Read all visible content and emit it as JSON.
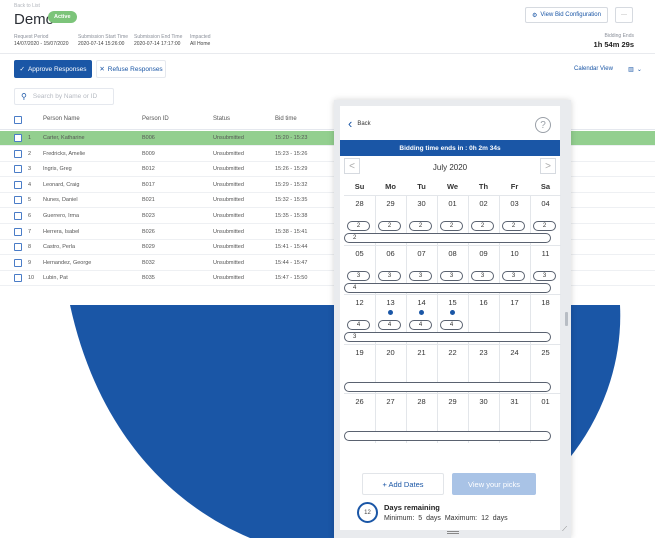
{
  "app": {
    "breadcrumb": "Back to List",
    "title": "Demo",
    "status": "Active",
    "meta": [
      {
        "label": "Request Period",
        "value": "14/07/2020 - 15/07/2020"
      },
      {
        "label": "Submission Start Time",
        "value": "2020-07-14 15:26:00"
      },
      {
        "label": "Submission End Time",
        "value": "2020-07-14 17:17:00"
      },
      {
        "label": "Impacted",
        "value": "All Home"
      }
    ],
    "view_bid_config": "View Bid Configuration",
    "more": "···",
    "bidding_ends_label": "Bidding Ends",
    "bidding_ends_value": "1h 54m 29s",
    "approve": "Approve Responses",
    "refuse": "Refuse Responses",
    "calendar_view": "Calendar View",
    "search_placeholder": "Search by Name or ID",
    "columns": [
      "Person Name",
      "Person ID",
      "Status",
      "Bid time"
    ],
    "rows": [
      {
        "n": "1",
        "name": "Carter, Katharine",
        "id": "B006",
        "status": "Unsubmitted",
        "time": "15:20 - 15:23"
      },
      {
        "n": "2",
        "name": "Fredricks, Amelie",
        "id": "B009",
        "status": "Unsubmitted",
        "time": "15:23 - 15:26"
      },
      {
        "n": "3",
        "name": "Ingris, Greg",
        "id": "B012",
        "status": "Unsubmitted",
        "time": "15:26 - 15:29"
      },
      {
        "n": "4",
        "name": "Leonard, Craig",
        "id": "B017",
        "status": "Unsubmitted",
        "time": "15:29 - 15:32"
      },
      {
        "n": "5",
        "name": "Nunes, Daniel",
        "id": "B021",
        "status": "Unsubmitted",
        "time": "15:32 - 15:35"
      },
      {
        "n": "6",
        "name": "Guerrero, Irma",
        "id": "B023",
        "status": "Unsubmitted",
        "time": "15:35 - 15:38"
      },
      {
        "n": "7",
        "name": "Herrera, Isabel",
        "id": "B026",
        "status": "Unsubmitted",
        "time": "15:38 - 15:41"
      },
      {
        "n": "8",
        "name": "Castro, Perla",
        "id": "B029",
        "status": "Unsubmitted",
        "time": "15:41 - 15:44"
      },
      {
        "n": "9",
        "name": "Hernandez, George",
        "id": "B032",
        "status": "Unsubmitted",
        "time": "15:44 - 15:47"
      },
      {
        "n": "10",
        "name": "Lubin, Pat",
        "id": "B035",
        "status": "Unsubmitted",
        "time": "15:47 - 15:50"
      }
    ]
  },
  "calendar": {
    "back": "Back",
    "help": "?",
    "bid_banner": "Bidding time ends in : 0h 2m 34s",
    "month": "July 2020",
    "prev": "<",
    "next": ">",
    "weekdays": [
      "Su",
      "Mo",
      "Tu",
      "We",
      "Th",
      "Fr",
      "Sa"
    ],
    "weeks": [
      {
        "days": [
          "28",
          "29",
          "30",
          "01",
          "02",
          "03",
          "04"
        ],
        "counts": [
          "2",
          "2",
          "2",
          "2",
          "2",
          "2",
          "2"
        ],
        "dots": [],
        "summary": "2"
      },
      {
        "days": [
          "05",
          "06",
          "07",
          "08",
          "09",
          "10",
          "11"
        ],
        "counts": [
          "3",
          "3",
          "3",
          "3",
          "3",
          "3",
          "3"
        ],
        "dots": [],
        "summary": "4"
      },
      {
        "days": [
          "12",
          "13",
          "14",
          "15",
          "16",
          "17",
          "18"
        ],
        "counts": [
          "4",
          "4",
          "4",
          "4",
          "",
          "",
          ""
        ],
        "dots": [
          1,
          2,
          3
        ],
        "summary": "3"
      },
      {
        "days": [
          "19",
          "20",
          "21",
          "22",
          "23",
          "24",
          "25"
        ],
        "counts": [
          "",
          "",
          "",
          "",
          "",
          "",
          ""
        ],
        "dots": [],
        "summary": ""
      },
      {
        "days": [
          "26",
          "27",
          "28",
          "29",
          "30",
          "31",
          "01"
        ],
        "counts": [
          "",
          "",
          "",
          "",
          "",
          "",
          ""
        ],
        "dots": [],
        "summary": ""
      }
    ],
    "add_dates": "+ Add Dates",
    "view_picks": "View your picks",
    "remaining_count": "12",
    "remaining_title": "Days remaining",
    "remaining_sub": "Minimum:  5  days  Maximum:  12  days"
  },
  "colors": {
    "primary": "#1a56a6",
    "highlight_row": "#93cf8f",
    "badge": "#7cc47a",
    "picks_disabled": "#a9c3e6"
  }
}
